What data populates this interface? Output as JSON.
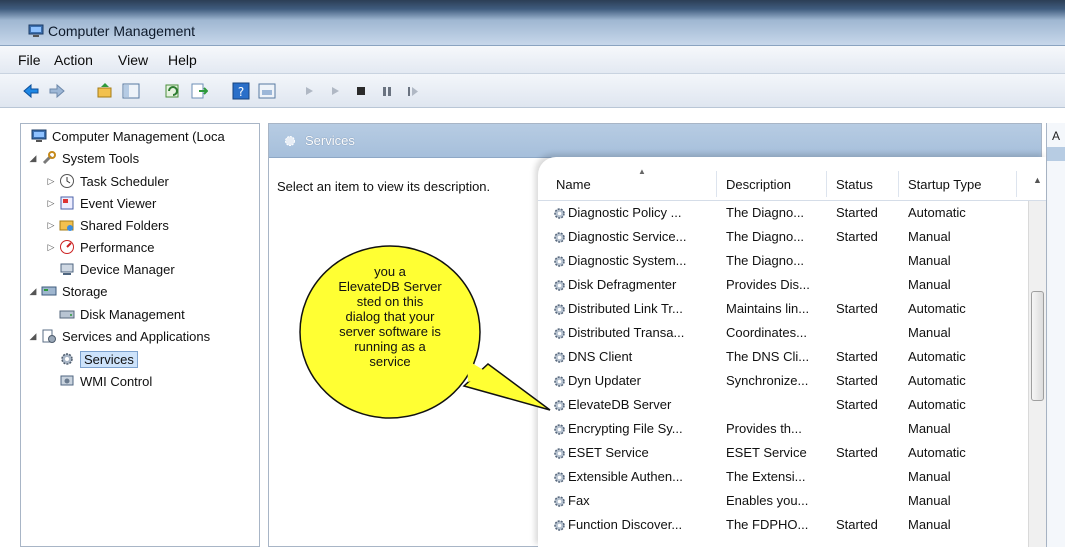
{
  "window": {
    "title": "Computer Management"
  },
  "menu": [
    "File",
    "Action",
    "View",
    "Help"
  ],
  "toolbar_icons": [
    "back-arrow-icon",
    "forward-arrow-icon",
    "up-folder-icon",
    "show-hide-tree-icon",
    "refresh-icon",
    "export-icon",
    "help-icon",
    "properties-icon",
    "play-icon",
    "play-next-icon",
    "stop-icon",
    "pause-icon",
    "restart-icon"
  ],
  "tree": {
    "root": "Computer Management (Loca",
    "system_tools": "System Tools",
    "task_scheduler": "Task Scheduler",
    "event_viewer": "Event Viewer",
    "shared_folders": "Shared Folders",
    "performance": "Performance",
    "device_manager": "Device Manager",
    "storage": "Storage",
    "disk_management": "Disk Management",
    "services_and_apps": "Services and Applications",
    "services": "Services",
    "wmi_control": "WMI Control"
  },
  "main": {
    "header_title": "Services",
    "description": "Select an item to view its description.",
    "columns": {
      "name": "Name",
      "description": "Description",
      "status": "Status",
      "startup": "Startup Type"
    }
  },
  "services": [
    {
      "name": "Diagnostic Policy ...",
      "description": "The Diagno...",
      "status": "Started",
      "startup": "Automatic"
    },
    {
      "name": "Diagnostic Service...",
      "description": "The Diagno...",
      "status": "Started",
      "startup": "Manual"
    },
    {
      "name": "Diagnostic System...",
      "description": "The Diagno...",
      "status": "",
      "startup": "Manual"
    },
    {
      "name": "Disk Defragmenter",
      "description": "Provides Dis...",
      "status": "",
      "startup": "Manual"
    },
    {
      "name": "Distributed Link Tr...",
      "description": "Maintains lin...",
      "status": "Started",
      "startup": "Automatic"
    },
    {
      "name": "Distributed Transa...",
      "description": "Coordinates...",
      "status": "",
      "startup": "Manual"
    },
    {
      "name": "DNS Client",
      "description": "The DNS Cli...",
      "status": "Started",
      "startup": "Automatic"
    },
    {
      "name": "Dyn Updater",
      "description": "Synchronize...",
      "status": "Started",
      "startup": "Automatic"
    },
    {
      "name": "ElevateDB Server",
      "description": "",
      "status": "Started",
      "startup": "Automatic"
    },
    {
      "name": "Encrypting File Sy...",
      "description": "Provides th...",
      "status": "",
      "startup": "Manual"
    },
    {
      "name": "ESET Service",
      "description": "ESET Service",
      "status": "Started",
      "startup": "Automatic"
    },
    {
      "name": "Extensible Authen...",
      "description": "The Extensi...",
      "status": "",
      "startup": "Manual"
    },
    {
      "name": "Fax",
      "description": "Enables you...",
      "status": "",
      "startup": "Manual"
    },
    {
      "name": "Function Discover...",
      "description": "The FDPHO...",
      "status": "Started",
      "startup": "Manual"
    }
  ],
  "callout": {
    "text": "you a\nElevateDB Server\nsted on this\ndialog that your\nserver software is\nrunning as a\nservice"
  },
  "action_pane": {
    "letter": "A"
  },
  "colors": {
    "callout_fill": "#ffff33",
    "header_blue": "#a6bfdb",
    "selection": "#cde3fb"
  }
}
